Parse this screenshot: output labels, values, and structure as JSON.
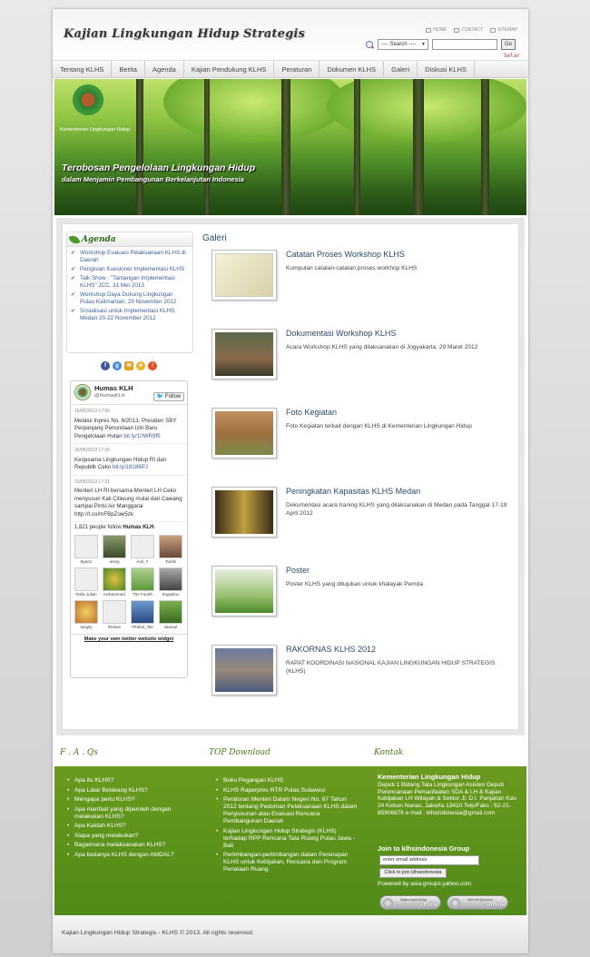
{
  "header": {
    "logo": "Kajian Lingkungan Hidup Strategis",
    "links": [
      "HOME",
      "CONTACT",
      "SITEMAP"
    ],
    "search_select": "---- Search ----",
    "search_go": "Go",
    "selar": "Selar"
  },
  "nav": [
    "Tentang KLHS",
    "Berita",
    "Agenda",
    "Kajian Pendukung KLHS",
    "Peraturan",
    "Dokumen KLHS",
    "Galeri",
    "Diskusi KLHS"
  ],
  "banner": {
    "org": "Kementerian Lingkungan Hidup",
    "slogan1": "Terobosan Pengelolaan Lingkungan Hidup",
    "slogan2": "dalam Menjamin Pembangunan Berkelanjutan Indonesia"
  },
  "agenda": {
    "title": "Agenda",
    "items": [
      "Workshop Evaluasi Pelaksanaan KLHS di Daerah",
      "Pengisian Kuesioner Implementasi KLHS",
      "Talk Show : \"Tantangan Implementasi KLHS\" JCC, 31 Mei 2013",
      "Workshop Daya Dukung Lingkungan Pulau Kalimantan, 29 November 2012",
      "Sosialisasi untuk Implementasi KLHS, Medan 20-22 November 2012"
    ]
  },
  "social": [
    "f",
    "g",
    "✉",
    "★",
    "!"
  ],
  "twitter": {
    "name": "Humas KLH",
    "handle": "@HumasKLH",
    "follow": "Follow",
    "tweets": [
      {
        "date": "15/05/2013 17:56",
        "text": "Melalui Inpres No. 6/2013, Presiden SBY Perpanjang Penundaan Izin Baru Pengelolaan Hutan",
        "link": "bit.ly/10WR9f5"
      },
      {
        "date": "15/05/2013 17:39",
        "text": "Kerjasama Lingkungan Hidup RI dan Republik Ceko",
        "link": "bit.ly/18186PJ"
      },
      {
        "date": "15/05/2013 17:31",
        "text": "Menteri LH RI bersama Menteri LH Ceko menyusuri Kali Ciliwung mulai dari Cawang sampai Pintu Air Manggarai http://t.co/mFBpZow5zk",
        "link": ""
      }
    ],
    "followers_count": "1,821 people follow",
    "followers_name": "Humas KLH",
    "followers": [
      "Byanz",
      "aning",
      "iAdi_Y",
      "Taufik",
      "Rolla Julian",
      "mohammad",
      "The Fourth",
      "Sugiatmo",
      "langky",
      "Ikhwan",
      "#Pabul_Tan",
      "samaul"
    ],
    "widget": "Make your own twitter website widget"
  },
  "galeri": {
    "title": "Galeri",
    "items": [
      {
        "title": "Catatan Proses Workshop KLHS",
        "desc": "Kumpulan catatan-catatan proses workhop KLHS"
      },
      {
        "title": "Dokumentasi Workshop KLHS",
        "desc": "Acara Workshop KLHS yang dilaksanakan di Jogyakarta, 29 Maret 2012"
      },
      {
        "title": "Foto Kegiatan",
        "desc": "Foto Kegiatan terkait dengan KLHS di Kementerian Lingkungan Hidup"
      },
      {
        "title": "Peningkatan Kapasitas KLHS Medan",
        "desc": "Dokumentasi acara traning KLHS yang dilaksanakan di Medan pada Tanggal 17-19 April 2012"
      },
      {
        "title": "Poster",
        "desc": "Poster KLHS yang ditujukan untuk khalayak Pemda"
      },
      {
        "title": "RAKORNAS KLHS 2012",
        "desc": "RAPAT KOORDINASI NASIONAL KAJIAN LINGKUNGAN HIDUP STRATEGIS (KLHS)"
      }
    ]
  },
  "footer": {
    "faq_title": "F . A . Qs",
    "faq": [
      "Apa itu KLHS?",
      "Apa Latar Belakang KLHS?",
      "Mengapa perlu KLHS?",
      "Apa manfaat yang diperoleh dengan melakukan KLHS?",
      "Apa Kaidah KLHS?",
      "Siapa yang melakukan?",
      "Bagaimana melaksanakan KLHS?",
      "Apa bedanya KLHS dengan AMDAL?"
    ],
    "download_title": "TOP Download",
    "downloads": [
      "Buku Pegangan KLHS",
      "KLHS Raperpres RTR Pulau Sulawesi",
      "Peraturan Menteri Dalam Negeri No. 67 Tahun 2012 tentang Pedoman Pelaksanaan KLHS dalam Penyusunan atau Evaluasi Rencana Pembangunan Daerah",
      "Kajian Lingkungan Hidup Strategis (KLHS) terhadap RPP Rencana Tata Ruang Pulau Jawa - Bali",
      "Pertimbangan-pertimbangan dalam Penerapan KLHS untuk Kebijakan, Rencana dan Program Penataan Ruang"
    ],
    "kontak_title": "Kontak",
    "kontak_org": "Kementerian Lingkungan Hidup",
    "kontak_addr": "Deputi 1 Bidang Tata Lingkungan Asisten Deputi Perencanaan Pemanfaatan SDA & LH & Kajian Kebijakan LH Wilayah & Sektor Jl. D.I. Panjaitan Kav. 24 Kebun Nanas, Jakarta 13410 Telp/Faks : 62-21-85906676 e-mail : klhsindonesia@gmail.com",
    "join_title": "Join to klhsindonesia Group",
    "join_placeholder": "enter email address",
    "join_button": "Click to join klhsindonesia",
    "powered": "Powered by asia.groups.yahoo.com",
    "ym": [
      {
        "id": "lingkunganhidup",
        "status": "offline"
      },
      {
        "id": "klhs.klh@yahoo",
        "status": "offline"
      }
    ]
  },
  "copyright": "Kajian Lingkungan Hidup Strategis - KLHS © 2013. All rights reserved."
}
